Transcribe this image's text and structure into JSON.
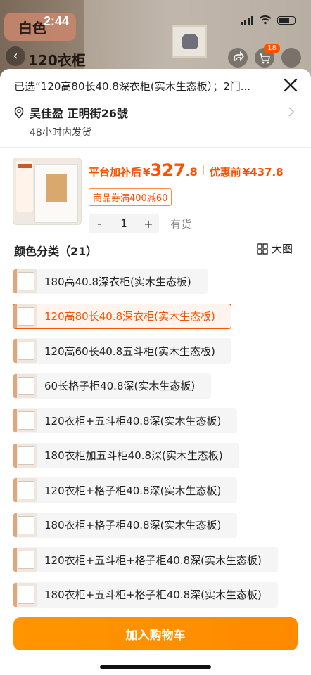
{
  "status": {
    "time": "2:44"
  },
  "background": {
    "badge_text": "白色",
    "product_title": "120衣柜",
    "cart_count": "18"
  },
  "sheet": {
    "selected_text": "已选“120高80长40.8深衣柜(实木生态板）；2门...",
    "address": "吴佳盈 正明街26號",
    "shipping": "48小时内发货"
  },
  "product": {
    "price_label": "平台加补后",
    "currency": "¥",
    "price_int": "327",
    "price_dec": ".8",
    "orig_label": "优惠前",
    "orig_price": "¥437.8",
    "coupon": "商品券满400减60",
    "qty_minus": "-",
    "qty": "1",
    "qty_plus": "+",
    "stock": "有货"
  },
  "category": {
    "title": "颜色分类（21）",
    "view_label": "大图",
    "options": [
      {
        "label": "180高40.8深衣柜(实木生态板)",
        "selected": false
      },
      {
        "label": "120高80长40.8深衣柜(实木生态板)",
        "selected": true
      },
      {
        "label": "120高60长40.8五斗柜(实木生态板)",
        "selected": false
      },
      {
        "label": "60长格子柜40.8深(实木生态板)",
        "selected": false
      },
      {
        "label": "120衣柜+五斗柜40.8深(实木生态板)",
        "selected": false
      },
      {
        "label": "180衣柜加五斗柜40.8深(实木生态板)",
        "selected": false
      },
      {
        "label": "120衣柜+格子柜40.8深(实木生态板)",
        "selected": false
      },
      {
        "label": "180衣柜+格子柜40.8深(实木生态板)",
        "selected": false
      },
      {
        "label": "120衣柜+五斗柜+格子柜40.8深(实木生态板)",
        "selected": false
      },
      {
        "label": "180衣柜+五斗柜+格子柜40.8深(实木生态板)",
        "selected": false
      }
    ]
  },
  "footer": {
    "add_to_cart": "加入购物车"
  },
  "colors": {
    "accent": "#ff5000",
    "button": "#ff9500"
  }
}
